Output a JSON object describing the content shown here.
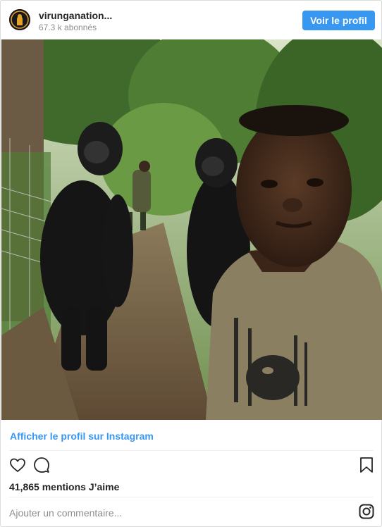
{
  "header": {
    "avatar_icon": "gorilla-silhouette-logo",
    "username": "virunganation...",
    "followers": "67.3 k abonnés",
    "view_profile_button": "Voir le profil"
  },
  "photo": {
    "description_icon": "photo"
  },
  "links": {
    "view_profile_link": "Afficher le profil sur Instagram"
  },
  "actions": {
    "like_icon": "heart-icon",
    "comment_icon": "comment-icon",
    "save_icon": "bookmark-icon"
  },
  "likes": {
    "text": "41,865 mentions J’aime"
  },
  "comment": {
    "placeholder": "Ajouter un commentaire..."
  },
  "colors": {
    "accent": "#3897f0",
    "text": "#262626",
    "muted": "#8e8e8e",
    "border": "#dbdbdb"
  }
}
